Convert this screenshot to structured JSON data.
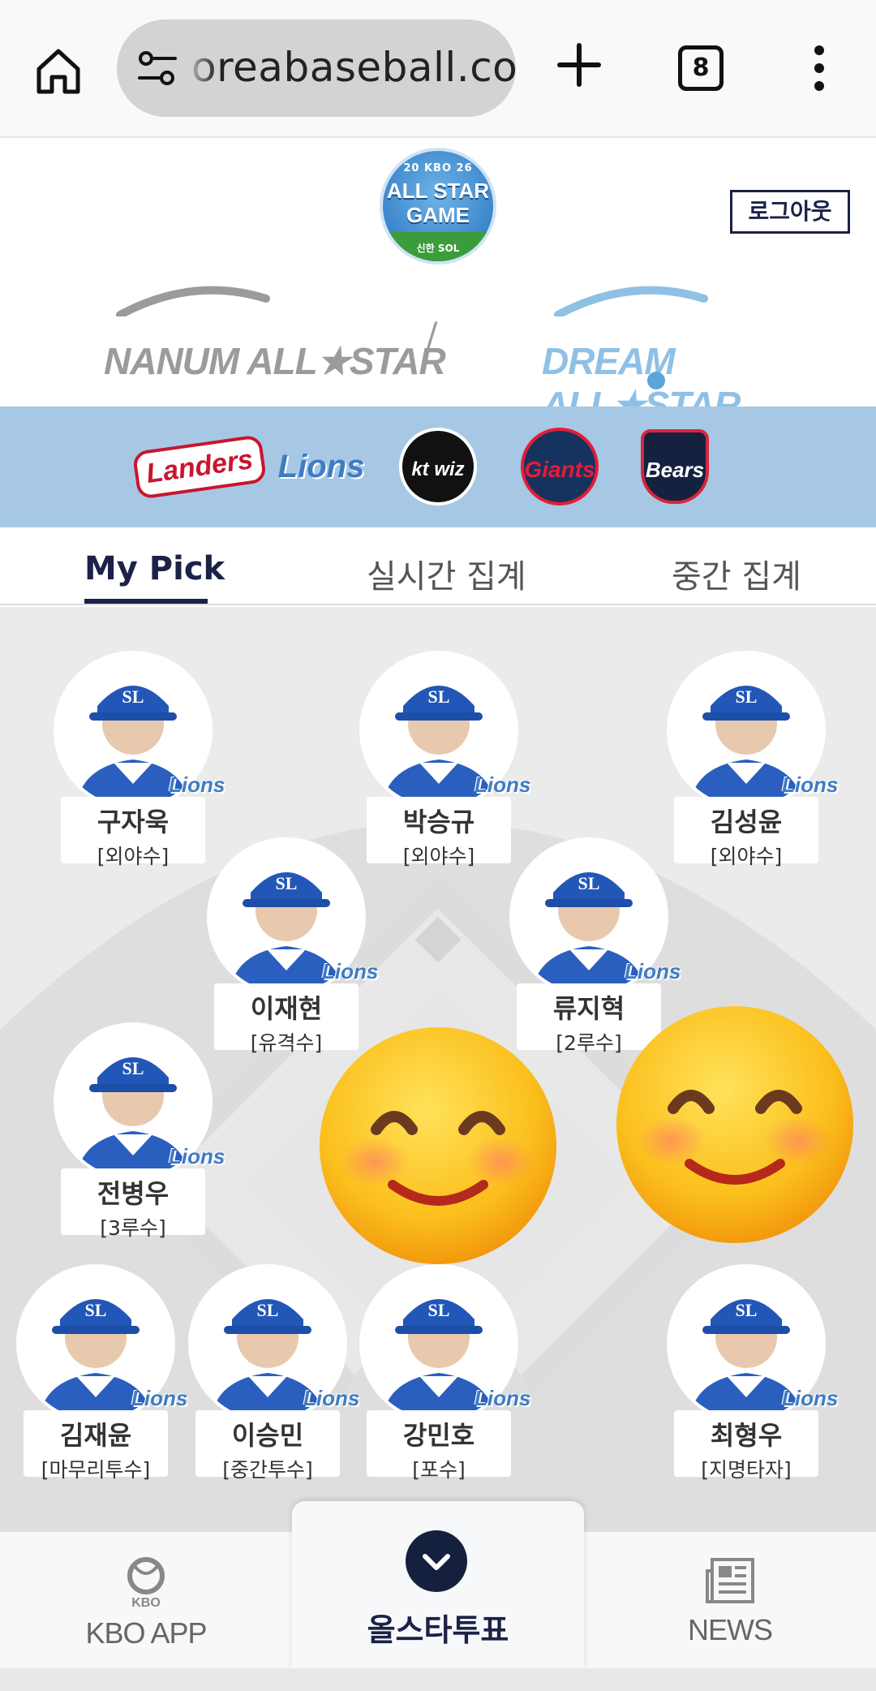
{
  "browser": {
    "url": "oreabaseball.com",
    "tab_count": "8"
  },
  "header": {
    "logo": {
      "top_text": "20 KBO 26",
      "main_text": "ALL STAR GAME",
      "sponsor": "신한 SOL"
    },
    "logout_label": "로그아웃",
    "leagues": [
      {
        "label": "NANUM ALL★STAR"
      },
      {
        "label": "DREAM ALL★STAR"
      }
    ],
    "separator": "/"
  },
  "teams": [
    {
      "name": "Landers"
    },
    {
      "name": "Lions"
    },
    {
      "name": "kt wiz"
    },
    {
      "name": "Giants"
    },
    {
      "name": "Bears"
    }
  ],
  "tabs": [
    {
      "label": "My Pick",
      "active": true
    },
    {
      "label": "실시간 집계",
      "active": false
    },
    {
      "label": "중간 집계",
      "active": false
    }
  ],
  "players": [
    {
      "name": "구자욱",
      "position": "[외야수]",
      "team": "Lions"
    },
    {
      "name": "박승규",
      "position": "[외야수]",
      "team": "Lions"
    },
    {
      "name": "김성윤",
      "position": "[외야수]",
      "team": "Lions"
    },
    {
      "name": "이재현",
      "position": "[유격수]",
      "team": "Lions"
    },
    {
      "name": "류지혁",
      "position": "[2루수]",
      "team": "Lions"
    },
    {
      "name": "전병우",
      "position": "[3루수]",
      "team": "Lions"
    },
    {
      "name": "김재윤",
      "position": "[마무리투수]",
      "team": "Lions"
    },
    {
      "name": "이승민",
      "position": "[중간투수]",
      "team": "Lions"
    },
    {
      "name": "강민호",
      "position": "[포수]",
      "team": "Lions"
    },
    {
      "name": "최형우",
      "position": "[지명타자]",
      "team": "Lions"
    }
  ],
  "bottom_nav": {
    "kbo_app": "KBO APP",
    "kbo_logo_text": "KBO",
    "vote": "올스타투표",
    "news": "NEWS"
  },
  "colors": {
    "navy": "#1a2247",
    "team_band": "#a7c8e4",
    "lions_blue": "#3f7cc3",
    "field_bg": "#ebebeb"
  }
}
